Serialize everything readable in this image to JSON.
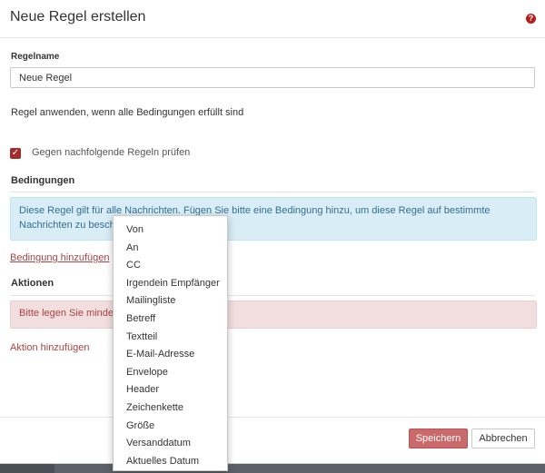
{
  "dialog": {
    "title": "Neue Regel erstellen",
    "help_icon": "question-circle-icon",
    "accent_color": "#a52a2a"
  },
  "form": {
    "rulename_label": "Regelname",
    "rulename_value": "Neue Regel",
    "apply_text": "Regel anwenden, wenn alle Bedingungen erfüllt sind",
    "check_following_label": "Gegen nachfolgende Regeln prüfen",
    "check_following_checked": true
  },
  "conditions": {
    "title": "Bedingungen",
    "info_line1": "Diese Regel gilt für alle Nachrichten. Fügen Sie bitte eine Bedingung hinzu, um diese Regel auf bestimmte",
    "info_line2": "Nachrichten zu beschr",
    "add_link": "Bedingung hinzufügen"
  },
  "actions": {
    "title": "Aktionen",
    "warning_text": "Bitte legen Sie mindes",
    "add_link": "Aktion hinzufügen"
  },
  "footer": {
    "save_label": "Speichern",
    "cancel_label": "Abbrechen"
  },
  "condition_dropdown": {
    "options": [
      "Von",
      "An",
      "CC",
      "Irgendein Empfänger",
      "Mailingliste",
      "Betreff",
      "Textteil",
      "E-Mail-Adresse",
      "Envelope",
      "Header",
      "Zeichenkette",
      "Größe",
      "Versanddatum",
      "Aktuelles Datum"
    ]
  }
}
